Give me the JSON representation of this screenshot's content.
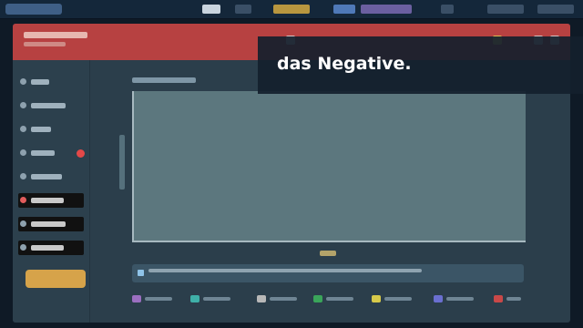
{
  "caption": {
    "text": "das Negative."
  },
  "colors": {
    "header": "#b74141",
    "sidebar": "#2c404d",
    "chart_fill": "#5c777e",
    "accent_button": "#d6a34a",
    "alert_badge": "#e34848",
    "legend": [
      "#9b6fc0",
      "#3fb0a8",
      "#b8b8b8",
      "#3aa55a",
      "#d6c94a",
      "#6a6fd0",
      "#c94848"
    ]
  },
  "icons": {
    "header": [
      "grid-icon",
      "gold-star-icon",
      "help-icon",
      "settings-icon"
    ],
    "sidebar_dot": "circle-icon",
    "info": "info-icon"
  }
}
